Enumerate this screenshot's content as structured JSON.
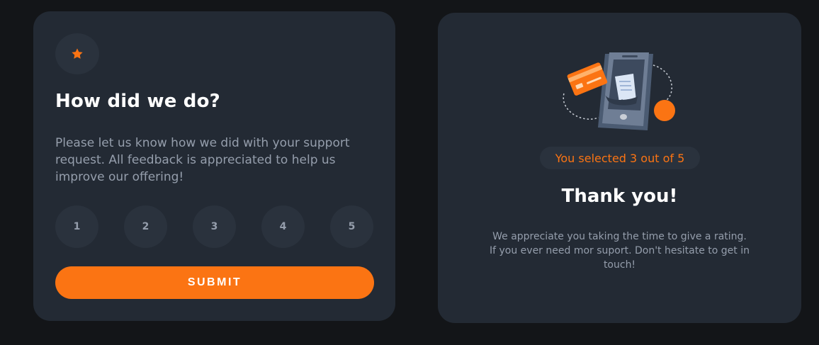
{
  "rating_card": {
    "title": "How did we do?",
    "description": "Please let us know how we did with your support request. All feedback is appreciated to help us improve our offering!",
    "ratings": [
      "1",
      "2",
      "3",
      "4",
      "5"
    ],
    "submit_label": "SUBMIT"
  },
  "thanks_card": {
    "selected_text": "You selected 3 out of 5",
    "selected_value": 3,
    "max_value": 5,
    "title": "Thank you!",
    "description": "We appreciate you taking the time to give a rating. If you ever need mor suport. Don't hesitate to get in touch!"
  },
  "colors": {
    "page_background": "#131518",
    "card_background": "#232a34",
    "accent_orange": "#fb7413",
    "button_background": "#2a323d",
    "muted_text": "#959eac",
    "white": "#ffffff"
  },
  "icons": {
    "rating_card_icon": "star-icon",
    "thanks_card_illustration": "phone-payment-illustration"
  }
}
